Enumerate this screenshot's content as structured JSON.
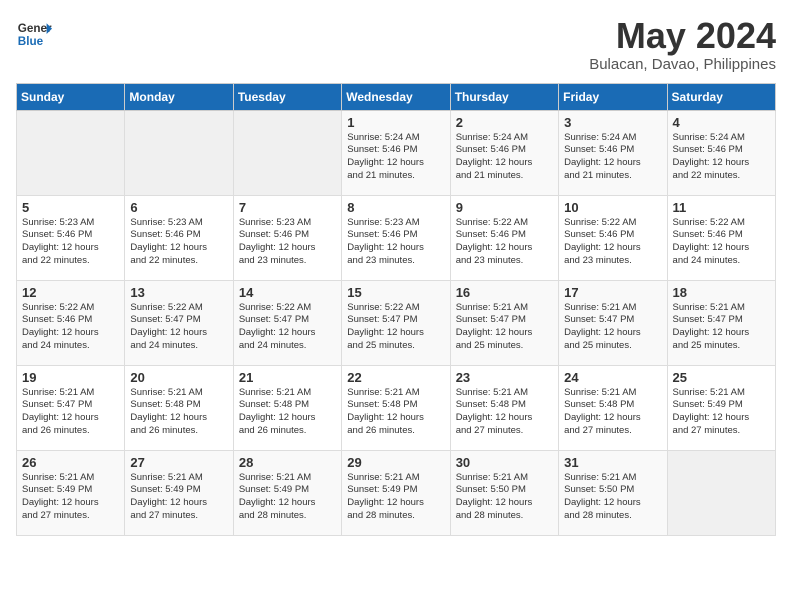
{
  "logo": {
    "line1": "General",
    "line2": "Blue"
  },
  "title": "May 2024",
  "location": "Bulacan, Davao, Philippines",
  "weekdays": [
    "Sunday",
    "Monday",
    "Tuesday",
    "Wednesday",
    "Thursday",
    "Friday",
    "Saturday"
  ],
  "weeks": [
    [
      {
        "day": "",
        "info": ""
      },
      {
        "day": "",
        "info": ""
      },
      {
        "day": "",
        "info": ""
      },
      {
        "day": "1",
        "info": "Sunrise: 5:24 AM\nSunset: 5:46 PM\nDaylight: 12 hours\nand 21 minutes."
      },
      {
        "day": "2",
        "info": "Sunrise: 5:24 AM\nSunset: 5:46 PM\nDaylight: 12 hours\nand 21 minutes."
      },
      {
        "day": "3",
        "info": "Sunrise: 5:24 AM\nSunset: 5:46 PM\nDaylight: 12 hours\nand 21 minutes."
      },
      {
        "day": "4",
        "info": "Sunrise: 5:24 AM\nSunset: 5:46 PM\nDaylight: 12 hours\nand 22 minutes."
      }
    ],
    [
      {
        "day": "5",
        "info": "Sunrise: 5:23 AM\nSunset: 5:46 PM\nDaylight: 12 hours\nand 22 minutes."
      },
      {
        "day": "6",
        "info": "Sunrise: 5:23 AM\nSunset: 5:46 PM\nDaylight: 12 hours\nand 22 minutes."
      },
      {
        "day": "7",
        "info": "Sunrise: 5:23 AM\nSunset: 5:46 PM\nDaylight: 12 hours\nand 23 minutes."
      },
      {
        "day": "8",
        "info": "Sunrise: 5:23 AM\nSunset: 5:46 PM\nDaylight: 12 hours\nand 23 minutes."
      },
      {
        "day": "9",
        "info": "Sunrise: 5:22 AM\nSunset: 5:46 PM\nDaylight: 12 hours\nand 23 minutes."
      },
      {
        "day": "10",
        "info": "Sunrise: 5:22 AM\nSunset: 5:46 PM\nDaylight: 12 hours\nand 23 minutes."
      },
      {
        "day": "11",
        "info": "Sunrise: 5:22 AM\nSunset: 5:46 PM\nDaylight: 12 hours\nand 24 minutes."
      }
    ],
    [
      {
        "day": "12",
        "info": "Sunrise: 5:22 AM\nSunset: 5:46 PM\nDaylight: 12 hours\nand 24 minutes."
      },
      {
        "day": "13",
        "info": "Sunrise: 5:22 AM\nSunset: 5:47 PM\nDaylight: 12 hours\nand 24 minutes."
      },
      {
        "day": "14",
        "info": "Sunrise: 5:22 AM\nSunset: 5:47 PM\nDaylight: 12 hours\nand 24 minutes."
      },
      {
        "day": "15",
        "info": "Sunrise: 5:22 AM\nSunset: 5:47 PM\nDaylight: 12 hours\nand 25 minutes."
      },
      {
        "day": "16",
        "info": "Sunrise: 5:21 AM\nSunset: 5:47 PM\nDaylight: 12 hours\nand 25 minutes."
      },
      {
        "day": "17",
        "info": "Sunrise: 5:21 AM\nSunset: 5:47 PM\nDaylight: 12 hours\nand 25 minutes."
      },
      {
        "day": "18",
        "info": "Sunrise: 5:21 AM\nSunset: 5:47 PM\nDaylight: 12 hours\nand 25 minutes."
      }
    ],
    [
      {
        "day": "19",
        "info": "Sunrise: 5:21 AM\nSunset: 5:47 PM\nDaylight: 12 hours\nand 26 minutes."
      },
      {
        "day": "20",
        "info": "Sunrise: 5:21 AM\nSunset: 5:48 PM\nDaylight: 12 hours\nand 26 minutes."
      },
      {
        "day": "21",
        "info": "Sunrise: 5:21 AM\nSunset: 5:48 PM\nDaylight: 12 hours\nand 26 minutes."
      },
      {
        "day": "22",
        "info": "Sunrise: 5:21 AM\nSunset: 5:48 PM\nDaylight: 12 hours\nand 26 minutes."
      },
      {
        "day": "23",
        "info": "Sunrise: 5:21 AM\nSunset: 5:48 PM\nDaylight: 12 hours\nand 27 minutes."
      },
      {
        "day": "24",
        "info": "Sunrise: 5:21 AM\nSunset: 5:48 PM\nDaylight: 12 hours\nand 27 minutes."
      },
      {
        "day": "25",
        "info": "Sunrise: 5:21 AM\nSunset: 5:49 PM\nDaylight: 12 hours\nand 27 minutes."
      }
    ],
    [
      {
        "day": "26",
        "info": "Sunrise: 5:21 AM\nSunset: 5:49 PM\nDaylight: 12 hours\nand 27 minutes."
      },
      {
        "day": "27",
        "info": "Sunrise: 5:21 AM\nSunset: 5:49 PM\nDaylight: 12 hours\nand 27 minutes."
      },
      {
        "day": "28",
        "info": "Sunrise: 5:21 AM\nSunset: 5:49 PM\nDaylight: 12 hours\nand 28 minutes."
      },
      {
        "day": "29",
        "info": "Sunrise: 5:21 AM\nSunset: 5:49 PM\nDaylight: 12 hours\nand 28 minutes."
      },
      {
        "day": "30",
        "info": "Sunrise: 5:21 AM\nSunset: 5:50 PM\nDaylight: 12 hours\nand 28 minutes."
      },
      {
        "day": "31",
        "info": "Sunrise: 5:21 AM\nSunset: 5:50 PM\nDaylight: 12 hours\nand 28 minutes."
      },
      {
        "day": "",
        "info": ""
      }
    ]
  ]
}
